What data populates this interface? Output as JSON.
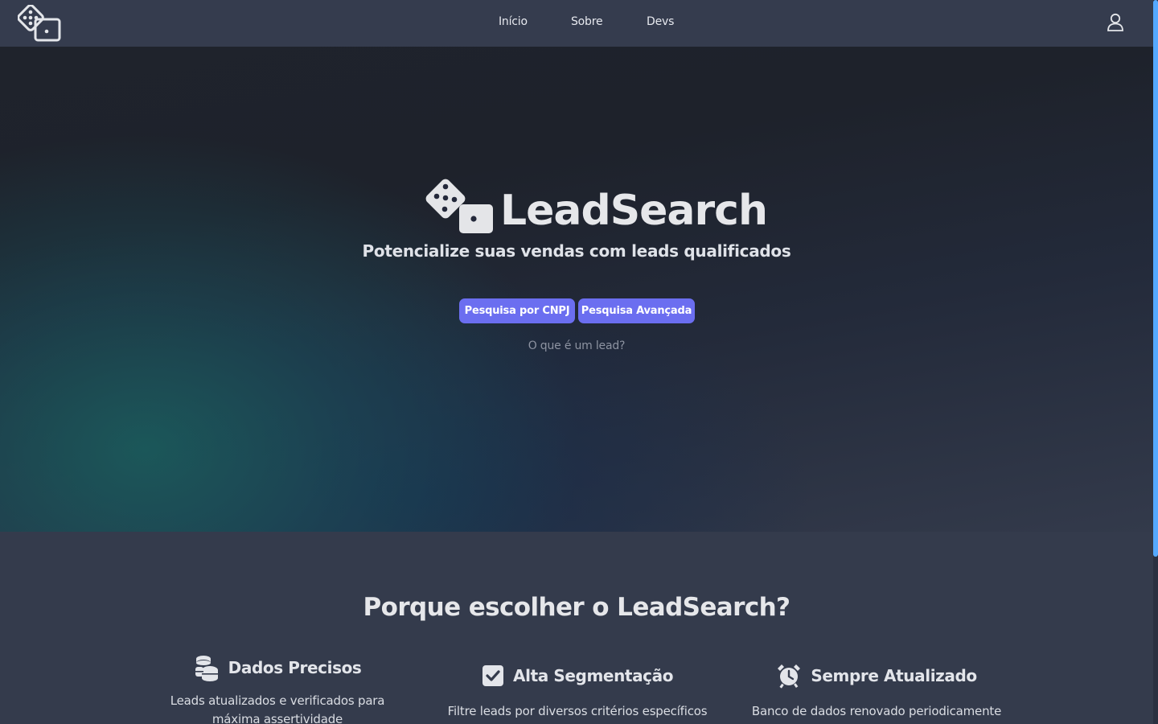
{
  "nav": {
    "links": [
      {
        "label": "Início"
      },
      {
        "label": "Sobre"
      },
      {
        "label": "Devs"
      }
    ]
  },
  "hero": {
    "brand": "LeadSearch",
    "subtitle": "Potencialize suas vendas com leads qualificados",
    "buttons": [
      {
        "label": "Pesquisa por CNPJ"
      },
      {
        "label": "Pesquisa Avançada"
      }
    ],
    "lead_link": "O que é um lead?"
  },
  "why": {
    "title": "Porque escolher o LeadSearch?",
    "features": [
      {
        "icon": "coins-icon",
        "title": "Dados Precisos",
        "description": "Leads atualizados e verificados para máxima assertividade"
      },
      {
        "icon": "checkbox-icon",
        "title": "Alta Segmentação",
        "description": "Filtre leads por diversos critérios específicos"
      },
      {
        "icon": "alarm-clock-icon",
        "title": "Sempre Atualizado",
        "description": "Banco de dados renovado periodicamente"
      }
    ]
  },
  "colors": {
    "navbar": "#353c4e",
    "accent_button": "#6b6ef0",
    "section_bg": "#343b4c",
    "scrollbar": "#55a9ff"
  }
}
